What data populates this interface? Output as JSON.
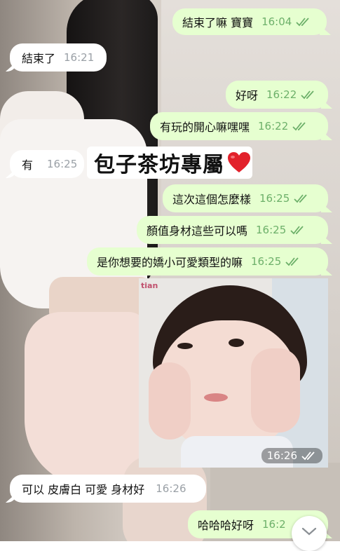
{
  "chat": {
    "messages": [
      {
        "text": "結束了嘛 寶寶",
        "time": "16:04",
        "direction": "out"
      },
      {
        "text": "結束了",
        "time": "16:21",
        "direction": "in"
      },
      {
        "text": "好呀",
        "time": "16:22",
        "direction": "out"
      },
      {
        "text": "有玩的開心嘛嘿嘿",
        "time": "16:22",
        "direction": "out"
      },
      {
        "text": "有",
        "time": "16:25",
        "direction": "in"
      },
      {
        "text": "這次這個怎麼樣",
        "time": "16:25",
        "direction": "out"
      },
      {
        "text": "顏值身材這些可以嗎",
        "time": "16:25",
        "direction": "out"
      },
      {
        "text": "是你想要的嬌小可愛類型的嘛",
        "time": "16:25",
        "direction": "out"
      },
      {
        "text": "可以 皮膚白 可愛 身材好",
        "time": "16:26",
        "direction": "in"
      },
      {
        "text": "哈哈哈好呀",
        "time": "16:2",
        "direction": "out"
      }
    ],
    "sticker": {
      "text": "包子茶坊專屬",
      "icon": "red-heart-icon"
    },
    "photo": {
      "time": "16:26",
      "watermark": "tian",
      "icon": "photo-message"
    }
  },
  "controls": {
    "scroll_down_icon": "chevron-down-icon"
  },
  "colors": {
    "outgoing_bubble": "#e6ffd0",
    "incoming_bubble": "#ffffff",
    "out_time": "#6db06a",
    "in_time": "#9aa0a6",
    "heart": "#e2212b"
  }
}
